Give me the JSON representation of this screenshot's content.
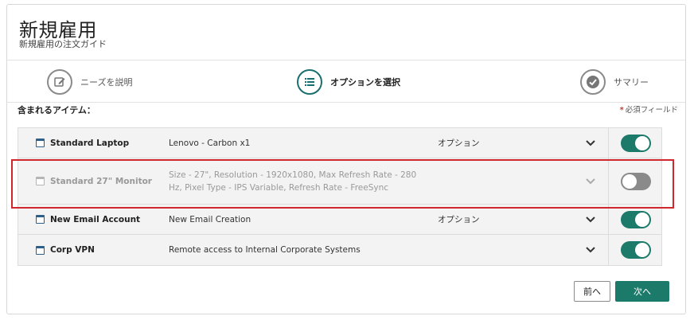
{
  "header": {
    "title": "新規雇用",
    "subtitle": "新規雇用の注文ガイド"
  },
  "steps": [
    {
      "label": "ニーズを説明",
      "icon": "edit-icon",
      "active": false
    },
    {
      "label": "オプションを選択",
      "icon": "list-icon",
      "active": true
    },
    {
      "label": "サマリー",
      "icon": "check-icon",
      "active": false
    }
  ],
  "section": {
    "included_label": "含まれるアイテム：",
    "required_star": "*",
    "required_note": "必須フィールド"
  },
  "items": [
    {
      "name": "Standard Laptop",
      "description": "Lenovo - Carbon x1",
      "option": "オプション",
      "enabled": true
    },
    {
      "name": "Standard 27\" Monitor",
      "description": "Size - 27\", Resolution - 1920x1080, Max Refresh Rate - 280 Hz, Pixel Type - IPS Variable, Refresh Rate - FreeSync",
      "option": "",
      "enabled": false
    },
    {
      "name": "New Email Account",
      "description": "New Email Creation",
      "option": "オプション",
      "enabled": true
    },
    {
      "name": "Corp VPN",
      "description": "Remote access to Internal Corporate Systems",
      "option": "",
      "enabled": true
    }
  ],
  "buttons": {
    "prev": "前へ",
    "next": "次へ"
  },
  "colors": {
    "accent": "#1b7a6a",
    "highlight": "#d0262e"
  }
}
